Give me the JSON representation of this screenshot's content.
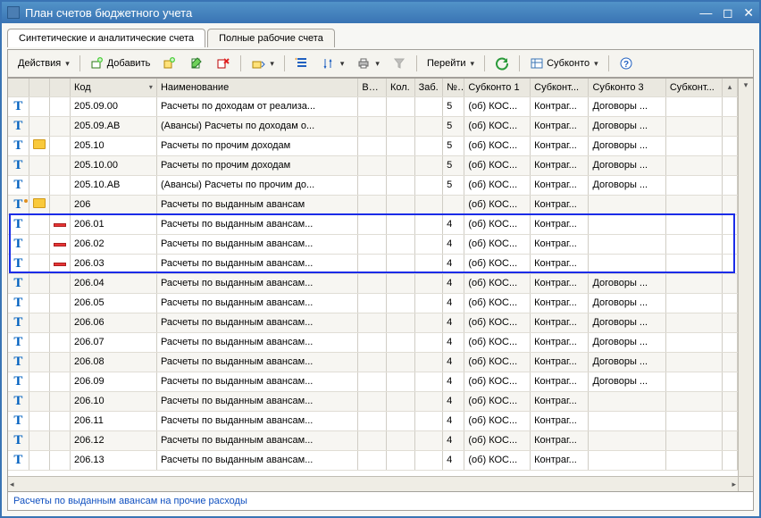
{
  "title": "План счетов бюджетного учета",
  "tabs": [
    {
      "label": "Синтетические и аналитические счета",
      "active": true
    },
    {
      "label": "Полные рабочие счета",
      "active": false
    }
  ],
  "toolbar": {
    "actions": "Действия",
    "add": "Добавить",
    "goto": "Перейти",
    "subkonto": "Субконто"
  },
  "columns": {
    "code": "Код",
    "name": "Наименование",
    "val": "Вал.",
    "kol": "Кол.",
    "zab": "Заб.",
    "no": "№ ...",
    "s1": "Субконто 1",
    "s2": "Субконт...",
    "s3": "Субконто 3",
    "s4": "Субконт..."
  },
  "rows": [
    {
      "t": "T",
      "folder": "",
      "pict": "",
      "code": "205.09.00",
      "name": "Расчеты по доходам от реализа...",
      "no": "5",
      "s1": "(об) КОС...",
      "s2": "Контраг...",
      "s3": "Договоры ..."
    },
    {
      "t": "T",
      "folder": "",
      "pict": "",
      "code": "205.09.АВ",
      "name": "(Авансы) Расчеты по доходам о...",
      "no": "5",
      "s1": "(об) КОС...",
      "s2": "Контраг...",
      "s3": "Договоры ..."
    },
    {
      "t": "T",
      "folder": "folder",
      "pict": "",
      "code": "205.10",
      "name": "Расчеты по прочим доходам",
      "no": "5",
      "s1": "(об) КОС...",
      "s2": "Контраг...",
      "s3": "Договоры ..."
    },
    {
      "t": "T",
      "folder": "",
      "pict": "",
      "code": "205.10.00",
      "name": "Расчеты по прочим доходам",
      "no": "5",
      "s1": "(об) КОС...",
      "s2": "Контраг...",
      "s3": "Договоры ..."
    },
    {
      "t": "T",
      "folder": "",
      "pict": "",
      "code": "205.10.АВ",
      "name": "(Авансы) Расчеты по прочим до...",
      "no": "5",
      "s1": "(об) КОС...",
      "s2": "Контраг...",
      "s3": "Договоры ..."
    },
    {
      "t": "T.",
      "folder": "folder",
      "pict": "",
      "code": "206",
      "name": "Расчеты по выданным авансам",
      "no": "",
      "s1": "(об) КОС...",
      "s2": "Контраг...",
      "s3": ""
    },
    {
      "t": "T",
      "folder": "",
      "pict": "red",
      "code": "206.01",
      "name": "Расчеты по выданным авансам...",
      "no": "4",
      "s1": "(об) КОС...",
      "s2": "Контраг...",
      "s3": "",
      "hl": true
    },
    {
      "t": "T",
      "folder": "",
      "pict": "red",
      "code": "206.02",
      "name": "Расчеты по выданным авансам...",
      "no": "4",
      "s1": "(об) КОС...",
      "s2": "Контраг...",
      "s3": "",
      "hl": true
    },
    {
      "t": "T",
      "folder": "",
      "pict": "red",
      "code": "206.03",
      "name": "Расчеты по выданным авансам...",
      "no": "4",
      "s1": "(об) КОС...",
      "s2": "Контраг...",
      "s3": "",
      "hl": true
    },
    {
      "t": "T",
      "folder": "",
      "pict": "",
      "code": "206.04",
      "name": "Расчеты по выданным авансам...",
      "no": "4",
      "s1": "(об) КОС...",
      "s2": "Контраг...",
      "s3": "Договоры ..."
    },
    {
      "t": "T",
      "folder": "",
      "pict": "",
      "code": "206.05",
      "name": "Расчеты по выданным авансам...",
      "no": "4",
      "s1": "(об) КОС...",
      "s2": "Контраг...",
      "s3": "Договоры ..."
    },
    {
      "t": "T",
      "folder": "",
      "pict": "",
      "code": "206.06",
      "name": "Расчеты по выданным авансам...",
      "no": "4",
      "s1": "(об) КОС...",
      "s2": "Контраг...",
      "s3": "Договоры ..."
    },
    {
      "t": "T",
      "folder": "",
      "pict": "",
      "code": "206.07",
      "name": "Расчеты по выданным авансам...",
      "no": "4",
      "s1": "(об) КОС...",
      "s2": "Контраг...",
      "s3": "Договоры ..."
    },
    {
      "t": "T",
      "folder": "",
      "pict": "",
      "code": "206.08",
      "name": "Расчеты по выданным авансам...",
      "no": "4",
      "s1": "(об) КОС...",
      "s2": "Контраг...",
      "s3": "Договоры ..."
    },
    {
      "t": "T",
      "folder": "",
      "pict": "",
      "code": "206.09",
      "name": "Расчеты по выданным авансам...",
      "no": "4",
      "s1": "(об) КОС...",
      "s2": "Контраг...",
      "s3": "Договоры ..."
    },
    {
      "t": "T",
      "folder": "",
      "pict": "",
      "code": "206.10",
      "name": "Расчеты по выданным авансам...",
      "no": "4",
      "s1": "(об) КОС...",
      "s2": "Контраг...",
      "s3": ""
    },
    {
      "t": "T",
      "folder": "",
      "pict": "",
      "code": "206.11",
      "name": "Расчеты по выданным авансам...",
      "no": "4",
      "s1": "(об) КОС...",
      "s2": "Контраг...",
      "s3": ""
    },
    {
      "t": "T",
      "folder": "",
      "pict": "",
      "code": "206.12",
      "name": "Расчеты по выданным авансам...",
      "no": "4",
      "s1": "(об) КОС...",
      "s2": "Контраг...",
      "s3": ""
    },
    {
      "t": "T",
      "folder": "",
      "pict": "",
      "code": "206.13",
      "name": "Расчеты по выданным авансам...",
      "no": "4",
      "s1": "(об) КОС...",
      "s2": "Контраг...",
      "s3": ""
    }
  ],
  "status": "Расчеты по выданным авансам на прочие расходы"
}
